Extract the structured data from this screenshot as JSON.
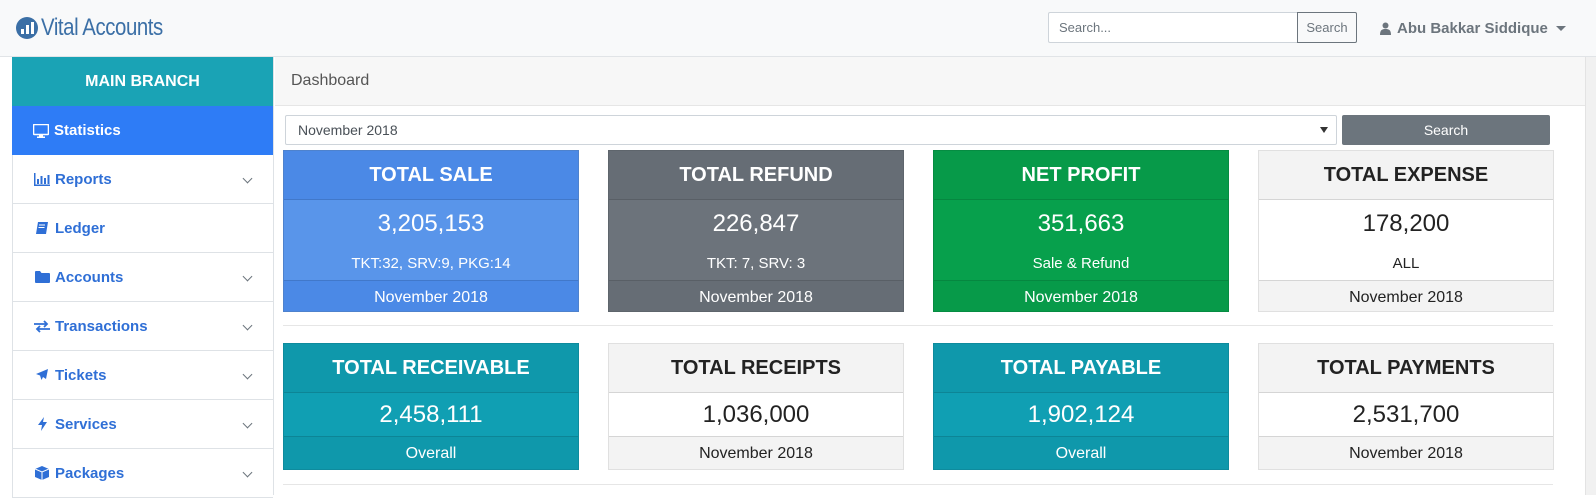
{
  "brand": {
    "name": "Vital Accounts",
    "icon": "chart-logo-icon"
  },
  "header": {
    "search_placeholder": "Search...",
    "search_button": "Search",
    "user_name": "Abu Bakkar Siddique",
    "user_icon": "user-icon"
  },
  "sidebar": {
    "branch": "MAIN BRANCH",
    "items": [
      {
        "label": "Statistics",
        "icon": "desktop-icon",
        "active": true,
        "expandable": false
      },
      {
        "label": "Reports",
        "icon": "bar-chart-icon",
        "active": false,
        "expandable": true
      },
      {
        "label": "Ledger",
        "icon": "book-icon",
        "active": false,
        "expandable": false
      },
      {
        "label": "Accounts",
        "icon": "folder-icon",
        "active": false,
        "expandable": true
      },
      {
        "label": "Transactions",
        "icon": "exchange-icon",
        "active": false,
        "expandable": true
      },
      {
        "label": "Tickets",
        "icon": "plane-icon",
        "active": false,
        "expandable": true
      },
      {
        "label": "Services",
        "icon": "bolt-icon",
        "active": false,
        "expandable": true
      },
      {
        "label": "Packages",
        "icon": "cube-icon",
        "active": false,
        "expandable": true
      }
    ]
  },
  "main": {
    "breadcrumb": "Dashboard",
    "period_select": "November 2018",
    "search_button": "Search",
    "cards": [
      {
        "title": "TOTAL SALE",
        "value": "3,205,153",
        "sub": "TKT:32, SRV:9, PKG:14",
        "footer": "November 2018"
      },
      {
        "title": "TOTAL REFUND",
        "value": "226,847",
        "sub": "TKT: 7, SRV: 3",
        "footer": "November 2018"
      },
      {
        "title": "NET PROFIT",
        "value": "351,663",
        "sub": "Sale & Refund",
        "footer": "November 2018"
      },
      {
        "title": "TOTAL EXPENSE",
        "value": "178,200",
        "sub": "ALL",
        "footer": "November 2018"
      },
      {
        "title": "TOTAL RECEIVABLE",
        "value": "2,458,111",
        "footer": "Overall"
      },
      {
        "title": "TOTAL RECEIPTS",
        "value": "1,036,000",
        "footer": "November 2018"
      },
      {
        "title": "TOTAL PAYABLE",
        "value": "1,902,124",
        "footer": "Overall"
      },
      {
        "title": "TOTAL PAYMENTS",
        "value": "2,531,700",
        "footer": "November 2018"
      }
    ]
  },
  "colors": {
    "brand": "#3b6fa6",
    "branch": "#1aa3b5",
    "active_menu": "#2e7cf6",
    "sale": "#5995ea",
    "refund": "#6c737b",
    "profit": "#07a04c",
    "teal": "#109fb3"
  }
}
